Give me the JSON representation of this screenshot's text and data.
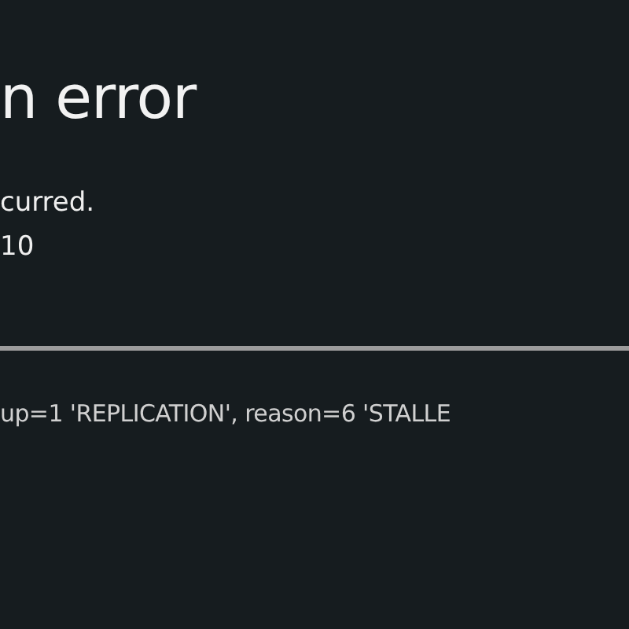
{
  "title": "n error",
  "message_lines": [
    "curred.",
    "10"
  ],
  "details": "up=1 'REPLICATION', reason=6 'STALLE"
}
